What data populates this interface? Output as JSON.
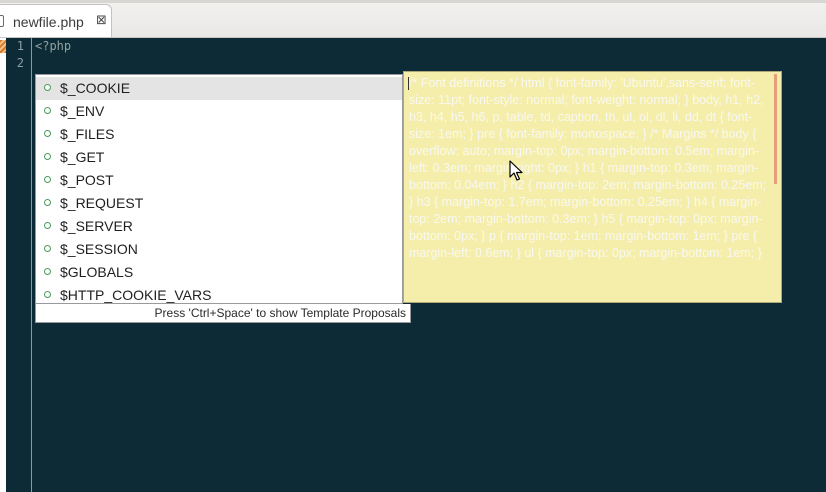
{
  "tab": {
    "label": "newfile.php",
    "close_glyph": "⊠"
  },
  "editor": {
    "line_numbers": [
      "1",
      "2"
    ],
    "lines": [
      "<?php",
      ""
    ]
  },
  "proposals": {
    "items": [
      {
        "label": "$_COOKIE",
        "selected": true
      },
      {
        "label": "$_ENV",
        "selected": false
      },
      {
        "label": "$_FILES",
        "selected": false
      },
      {
        "label": "$_GET",
        "selected": false
      },
      {
        "label": "$_POST",
        "selected": false
      },
      {
        "label": "$_REQUEST",
        "selected": false
      },
      {
        "label": "$_SERVER",
        "selected": false
      },
      {
        "label": "$_SESSION",
        "selected": false
      },
      {
        "label": "$GLOBALS",
        "selected": false
      },
      {
        "label": "$HTTP_COOKIE_VARS",
        "selected": false
      }
    ],
    "hint": "Press 'Ctrl+Space' to show Template Proposals"
  },
  "doc_popup": {
    "text": "/* Font definitions */ html { font-family: 'Ubuntu',sans-serif; font-size: 11pt; font-style: normal; font-weight: normal; } body, h1, h2, h3, h4, h5, h6, p, table, td, caption, th, ul, ol, dl, li, dd, dt { font-size: 1em; } pre { font-family: monospace; } /* Margins */ body { overflow: auto; margin-top: 0px; margin-bottom: 0.5em; margin-left: 0.3em; margin-right: 0px; } h1 { margin-top: 0.3em; margin-bottom: 0.04em; } h2 { margin-top: 2em; margin-bottom: 0.25em; } h3 { margin-top: 1.7em; margin-bottom: 0.25em; } h4 { margin-top: 2em; margin-bottom: 0.3em; } h5 { margin-top: 0px; margin-bottom: 0px; } p { margin-top: 1em; margin-bottom: 1em; } pre { margin-left: 0.6em; } ul { margin-top: 0px; margin-bottom: 1em; }"
  },
  "colors": {
    "editor_bg": "#0d2b36",
    "doc_bg": "#f5eeaa",
    "doc_text": "#f8f8f2",
    "proposal_dot": "#4a9a5c"
  }
}
